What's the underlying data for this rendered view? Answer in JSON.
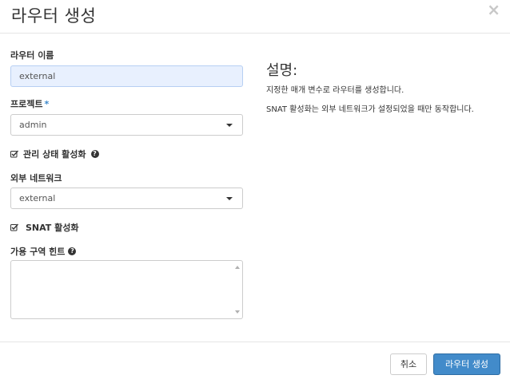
{
  "header": {
    "title": "라우터 생성",
    "close": "×"
  },
  "form": {
    "router_name": {
      "label": "라우터 이름",
      "value": "external"
    },
    "project": {
      "label": "프로젝트",
      "required": "*",
      "value": "admin"
    },
    "admin_state": {
      "label": "관리 상태 활성화",
      "checked": true,
      "help": "?"
    },
    "external_network": {
      "label": "외부 네트워크",
      "value": "external"
    },
    "snat": {
      "label": "SNAT 활성화",
      "checked": true
    },
    "az_hint": {
      "label": "가용 구역 힌트",
      "help": "?",
      "value": ""
    }
  },
  "description": {
    "title": "설명:",
    "p1": "지정한 매개 변수로 라우터를 생성합니다.",
    "p2": "SNAT 활성화는 외부 네트워크가 설정되었을 때만 동작합니다."
  },
  "footer": {
    "cancel": "취소",
    "submit": "라우터 생성"
  },
  "colors": {
    "primary": "#428bca",
    "required": "#3a87ca",
    "active_input": "#e8f0fe"
  }
}
